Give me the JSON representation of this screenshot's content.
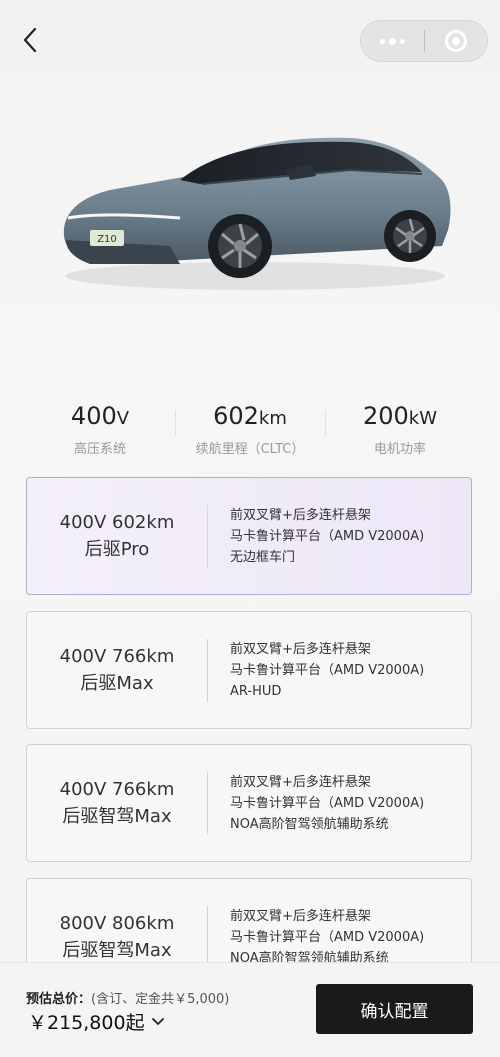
{
  "header": {
    "back_icon": "chevron-left-icon",
    "capsule_icons": [
      "more-dots-icon",
      "close-target-icon"
    ]
  },
  "car": {
    "plate_text": "Z10",
    "body_color": "#6a7d8a"
  },
  "specs": [
    {
      "value": "400",
      "unit": "V",
      "label": "高压系统"
    },
    {
      "value": "602",
      "unit": "km",
      "label": "续航里程（CLTC）"
    },
    {
      "value": "200",
      "unit": "kW",
      "label": "电机功率"
    }
  ],
  "options": [
    {
      "name_line1": "400V 602km",
      "name_line2": "后驱Pro",
      "features": [
        "前双叉臂+后多连杆悬架",
        "马卡鲁计算平台（AMD V2000A)",
        "无边框车门"
      ],
      "selected": true
    },
    {
      "name_line1": "400V 766km",
      "name_line2": "后驱Max",
      "features": [
        "前双叉臂+后多连杆悬架",
        "马卡鲁计算平台（AMD V2000A)",
        "AR-HUD"
      ],
      "selected": false
    },
    {
      "name_line1": "400V 766km",
      "name_line2": "后驱智驾Max",
      "features": [
        "前双叉臂+后多连杆悬架",
        "马卡鲁计算平台（AMD V2000A)",
        "NOA高阶智驾领航辅助系统"
      ],
      "selected": false
    },
    {
      "name_line1": "800V 806km",
      "name_line2": "后驱智驾Max",
      "features": [
        "前双叉臂+后多连杆悬架",
        "马卡鲁计算平台（AMD V2000A)",
        "NOA高阶智驾领航辅助系统"
      ],
      "selected": false
    }
  ],
  "bottom": {
    "price_label": "预估总价：",
    "price_note": "(含订、定金共￥5,000)",
    "price": "￥215,800起",
    "confirm_label": "确认配置"
  },
  "colors": {
    "selected_bg": "#ede7f7",
    "selected_border": "#b8a8d8",
    "confirm_bg": "#1a1a1a"
  }
}
